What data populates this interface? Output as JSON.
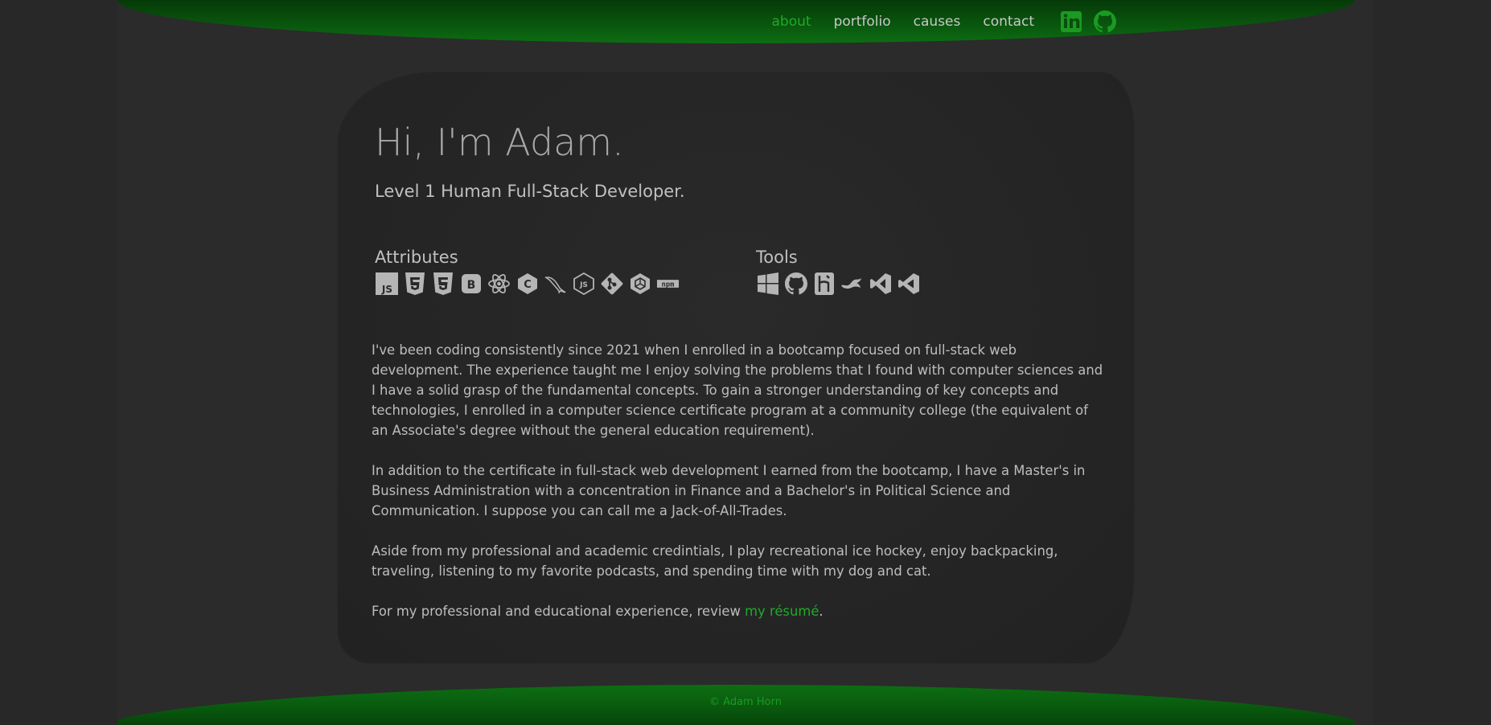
{
  "nav": {
    "items": [
      {
        "label": "about",
        "active": true
      },
      {
        "label": "portfolio",
        "active": false
      },
      {
        "label": "causes",
        "active": false
      },
      {
        "label": "contact",
        "active": false
      }
    ],
    "social": [
      {
        "icon": "linkedin-icon"
      },
      {
        "icon": "github-icon"
      }
    ]
  },
  "hero": {
    "title": "Hi, I'm Adam.",
    "subtitle": "Level 1 Human Full-Stack Developer."
  },
  "attributes": {
    "title": "Attributes",
    "icons": [
      "javascript-icon",
      "html5-icon",
      "css3-icon",
      "bootstrap-icon",
      "react-icon",
      "csharp-icon",
      "mysql-icon",
      "nodejs-icon",
      "git-icon",
      "sequelize-icon",
      "npm-icon"
    ]
  },
  "tools": {
    "title": "Tools",
    "icons": [
      "windows-icon",
      "github-icon",
      "heroku-icon",
      "insomnia-icon",
      "visual-studio-icon",
      "vscode-icon"
    ]
  },
  "bio": {
    "p1": "I've been coding consistently since 2021 when I enrolled in a bootcamp focused on full-stack web development. The experience taught me I enjoy solving the problems that I found with computer sciences and I have a solid grasp of the fundamental concepts. To gain a stronger understanding of key concepts and technologies, I enrolled in a computer science certificate program at a community college (the equivalent of an Associate's degree without the general education requirement).",
    "p2": "In addition to the certificate in full-stack web development I earned from the bootcamp, I have a Master's in Business Administration with a concentration in Finance and a Bachelor's in Political Science and Communication. I suppose you can call me a Jack-of-All-Trades.",
    "p3": "Aside from my professional and academic credintials, I play recreational ice hockey, enjoy backpacking, traveling, listening to my favorite podcasts, and spending time with my dog and cat.",
    "p4_prefix": "For my professional and educational experience, review ",
    "p4_link": "my résumé",
    "p4_suffix": "."
  },
  "footer": {
    "text": "© Adam Horn"
  },
  "colors": {
    "accent": "#1faa28",
    "header_green": "#0a5d0f",
    "background": "#2b2b2b"
  }
}
